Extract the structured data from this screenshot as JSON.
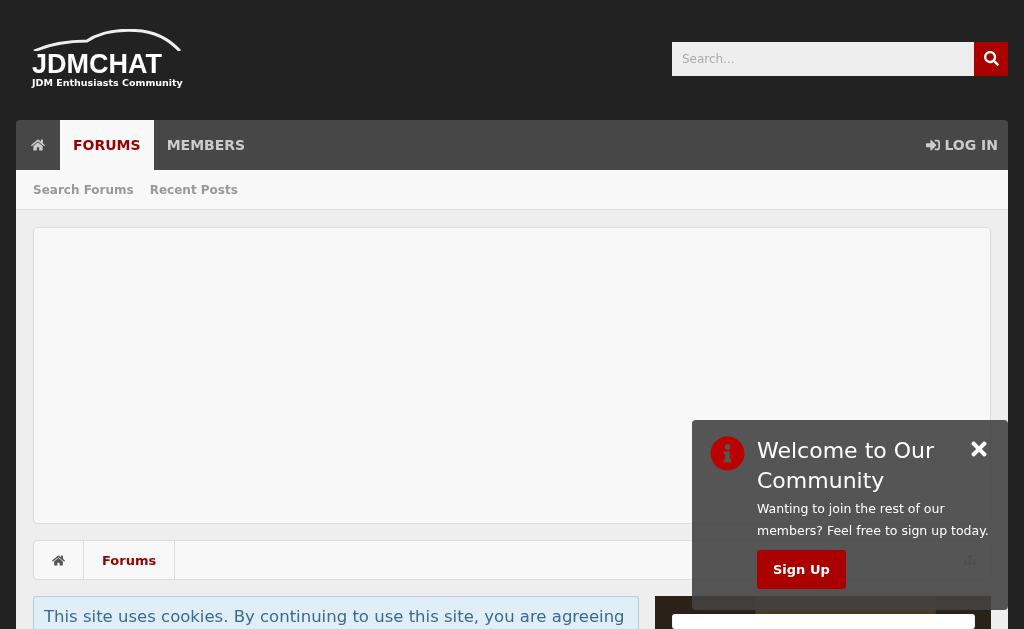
{
  "logo": {
    "title": "JDMCHAT",
    "tagline": "JDM Enthusiasts Community"
  },
  "search": {
    "placeholder": "Search..."
  },
  "nav": {
    "tabs": [
      {
        "kind": "home",
        "selected": false
      },
      {
        "kind": "text",
        "label": "FORUMS",
        "selected": true
      },
      {
        "kind": "text",
        "label": "MEMBERS",
        "selected": false
      }
    ],
    "login": "LOG IN"
  },
  "subnav": [
    "Search Forums",
    "Recent Posts"
  ],
  "breadcrumb": [
    "Forums"
  ],
  "cookie_notice": "This site uses cookies. By continuing to use this site, you are agreeing",
  "sidebar": {
    "kind": "picture"
  },
  "popup": {
    "title": "Welcome to Our Community",
    "text": "Wanting to join the rest of our members? Feel free to sign up today.",
    "button": "Sign Up"
  }
}
